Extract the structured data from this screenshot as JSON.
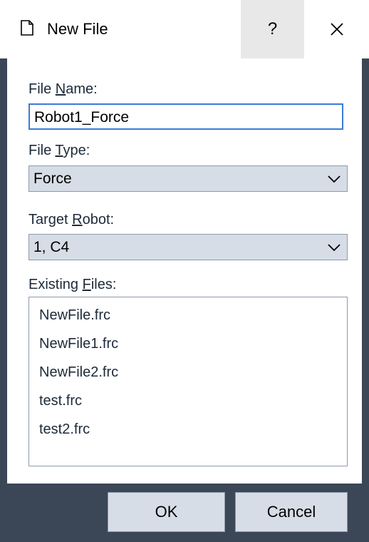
{
  "window": {
    "title": "New File",
    "help_label": "?",
    "close_icon": "close-icon",
    "file_icon": "document-icon"
  },
  "form": {
    "file_name": {
      "label_before": "File ",
      "label_accel": "N",
      "label_after": "ame:",
      "value": "Robot1_Force"
    },
    "file_type": {
      "label_before": "File ",
      "label_accel": "T",
      "label_after": "ype:",
      "selected": "Force"
    },
    "target_robot": {
      "label_before": "Target ",
      "label_accel": "R",
      "label_after": "obot:",
      "selected": "1, C4"
    },
    "existing_files": {
      "label_before": "Existing ",
      "label_accel": "F",
      "label_after": "iles:",
      "items": [
        "NewFile.frc",
        "NewFile1.frc",
        "NewFile2.frc",
        "test.frc",
        "test2.frc"
      ]
    }
  },
  "buttons": {
    "ok": "OK",
    "cancel": "Cancel"
  },
  "colors": {
    "accent_border": "#3a7bd5",
    "combo_bg": "#d7dde6",
    "frame": "#3b4657"
  }
}
